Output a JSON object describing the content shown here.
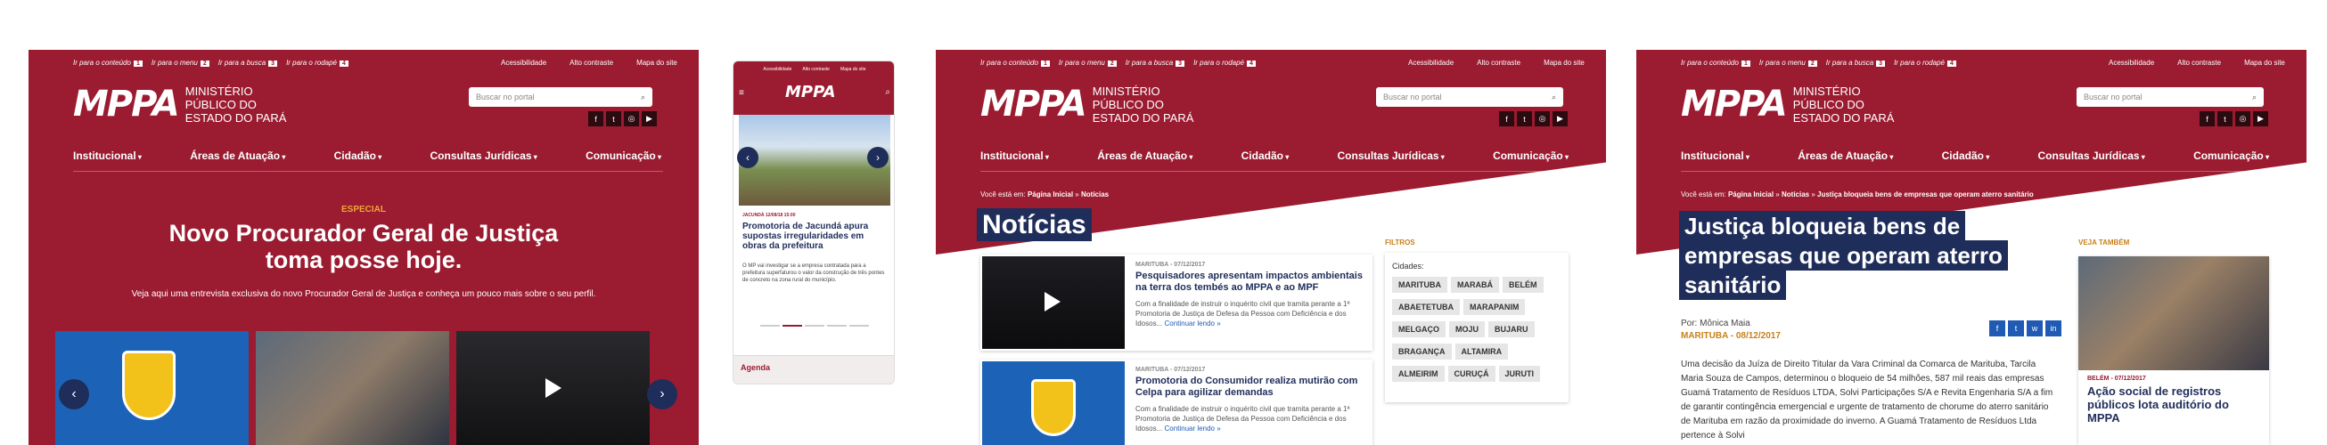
{
  "skip_links": [
    {
      "label": "Ir para o conteúdo",
      "key": "1"
    },
    {
      "label": "Ir para o menu",
      "key": "2"
    },
    {
      "label": "Ir para a busca",
      "key": "3"
    },
    {
      "label": "Ir para o rodapé",
      "key": "4"
    }
  ],
  "util_links": [
    "Acessibilidade",
    "Alto contraste",
    "Mapa do site"
  ],
  "logo": {
    "mark": "MPPA",
    "subtitle": "MINISTÉRIO PÚBLICO DO ESTADO DO PARÁ"
  },
  "search_placeholder": "Buscar no portal",
  "social": [
    "f",
    "t",
    "◎",
    "▶"
  ],
  "nav": [
    "Institucional",
    "Áreas de Atuação",
    "Cidadão",
    "Consultas Jurídicas",
    "Comunicação"
  ],
  "home": {
    "tag": "ESPECIAL",
    "title": "Novo Procurador Geral de Justiça toma posse hoje.",
    "lead": "Veja aqui uma entrevista exclusiva do novo Procurador Geral de Justiça e conheça um pouco mais sobre o seu perfil."
  },
  "mobile": {
    "util": [
      "Acessibilidade",
      "Alto contraste",
      "Mapa do site"
    ],
    "meta": "JACUNDÁ 12/08/18 15:00",
    "title": "Promotoria de Jacundá apura supostas irregularidades em obras da prefeitura",
    "text": "O MP vai investigar se a empresa contratada para a prefeitura superfaturou o valor da construção de três pontes de concreto na zona rural do município.",
    "agenda": "Agenda"
  },
  "noticias": {
    "crumb_prefix": "Você está em:",
    "crumb": [
      "Página Inicial",
      "Notícias"
    ],
    "title": "Notícias",
    "items": [
      {
        "meta": "MARITUBA - 07/12/2017",
        "title": "Pesquisadores apresentam impactos ambientais na terra dos tembés ao MPPA e ao MPF",
        "text": "Com a finalidade de instruir o inquérito civil que tramita perante a 1ª Promotoria de Justiça de Defesa da Pessoa com Deficiência e dos Idosos...",
        "more": "Continuar lendo »"
      },
      {
        "meta": "MARITUBA - 07/12/2017",
        "title": "Promotoria do Consumidor realiza mutirão com Celpa para agilizar demandas",
        "text": "Com a finalidade de instruir o inquérito civil que tramita perante a 1ª Promotoria de Justiça de Defesa da Pessoa com Deficiência e dos Idosos...",
        "more": "Continuar lendo »"
      }
    ],
    "filters_title": "FILTROS",
    "cities_label": "Cidades:",
    "cities": [
      "MARITUBA",
      "MARABÁ",
      "BELÉM",
      "ABAETETUBA",
      "MARAPANIM",
      "MELGAÇO",
      "MOJU",
      "BUJARU",
      "BRAGANÇA",
      "ALTAMIRA",
      "ALMEIRIM",
      "CURUÇÁ",
      "JURUTI"
    ]
  },
  "article": {
    "crumb_prefix": "Você está em:",
    "crumb": [
      "Página Inicial",
      "Notícias",
      "Justiça bloqueia bens de empresas que operam aterro sanitário"
    ],
    "title": "Justiça bloqueia bens de empresas que operam aterro sanitário",
    "author": "Por: Mônica Maia",
    "meta": "MARITUBA - 08/12/2017",
    "share": [
      "f",
      "t",
      "w",
      "in"
    ],
    "body": "Uma decisão da Juíza de Direito Titular da Vara Criminal da Comarca de Marituba, Tarcila Maria Souza de Campos, determinou o bloqueio de 54 milhões, 587 mil reais das empresas Guamá Tratamento de Resíduos LTDA, Solvi Participações S/A e Revita Engenharia S/A a fim de garantir contingência emergencial e urgente de tratamento de chorume do aterro sanitário de Marituba em razão da proximidade do inverno. A Guamá Tratamento de Resíduos Ltda pertence à Solvi",
    "see_also": "VEJA TAMBÉM",
    "related_meta": "BELÉM - 07/12/2017",
    "related_title": "Ação social de registros públicos lota auditório do MPPA"
  },
  "colors": {
    "brand": "#9b1b30",
    "navy": "#1f2d5a",
    "accent": "#c8801a"
  }
}
